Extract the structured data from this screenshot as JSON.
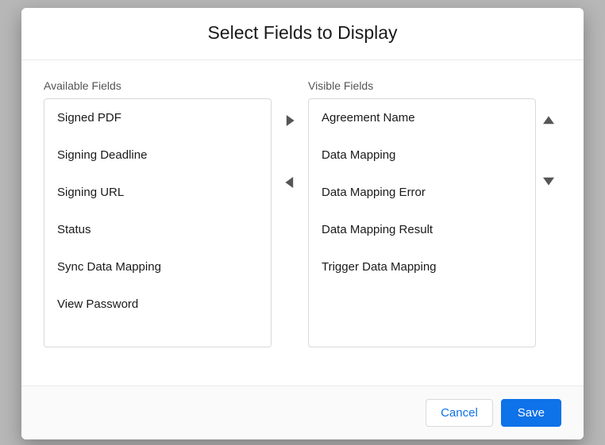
{
  "modal": {
    "title": "Select Fields to Display",
    "available_label": "Available Fields",
    "visible_label": "Visible Fields",
    "available_fields": [
      "Signed PDF",
      "Signing Deadline",
      "Signing URL",
      "Status",
      "Sync Data Mapping",
      "View Password"
    ],
    "visible_fields": [
      "Agreement Name",
      "Data Mapping",
      "Data Mapping Error",
      "Data Mapping Result",
      "Trigger Data Mapping"
    ],
    "cancel_label": "Cancel",
    "save_label": "Save"
  }
}
